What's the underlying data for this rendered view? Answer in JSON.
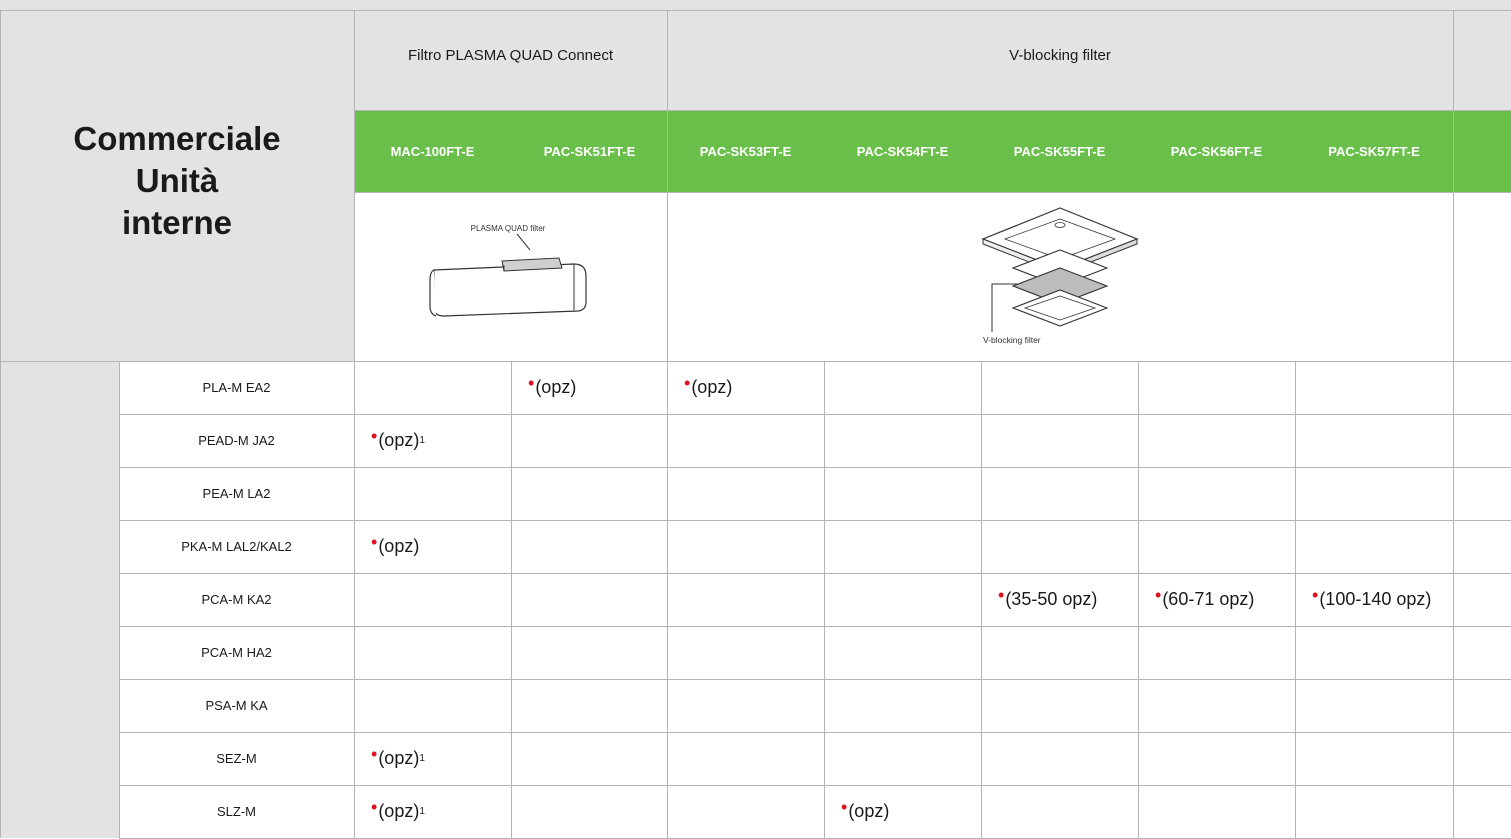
{
  "table": {
    "title_lines": [
      "Commerciale",
      "Unità",
      "interne"
    ],
    "groups": [
      {
        "label": "Filtro PLASMA QUAD Connect"
      },
      {
        "label": "V-blocking filter"
      }
    ],
    "codes": [
      "MAC-100FT-E",
      "PAC-SK51FT-E",
      "PAC-SK53FT-E",
      "PAC-SK54FT-E",
      "PAC-SK55FT-E",
      "PAC-SK56FT-E",
      "PAC-SK57FT-E"
    ],
    "image_labels": {
      "plasma": "PLASMA QUAD filter",
      "vblocking": "V-blocking filter"
    },
    "rows": [
      {
        "model": "PLA-M EA2",
        "values": [
          "",
          "(opz)",
          "(opz)",
          "",
          "",
          "",
          ""
        ]
      },
      {
        "model": "PEAD-M JA2",
        "values": [
          "(opz)¹",
          "",
          "",
          "",
          "",
          "",
          ""
        ]
      },
      {
        "model": "PEA-M LA2",
        "values": [
          "",
          "",
          "",
          "",
          "",
          "",
          ""
        ]
      },
      {
        "model": "PKA-M LAL2/KAL2",
        "values": [
          "(opz)",
          "",
          "",
          "",
          "",
          "",
          ""
        ]
      },
      {
        "model": "PCA-M KA2",
        "values": [
          "",
          "",
          "",
          "",
          "(35-50 opz)",
          "(60-71 opz)",
          "(100-140 opz)"
        ]
      },
      {
        "model": "PCA-M HA2",
        "values": [
          "",
          "",
          "",
          "",
          "",
          "",
          ""
        ]
      },
      {
        "model": "PSA-M KA",
        "values": [
          "",
          "",
          "",
          "",
          "",
          "",
          ""
        ]
      },
      {
        "model": "SEZ-M",
        "values": [
          "(opz)¹",
          "",
          "",
          "",
          "",
          "",
          ""
        ]
      },
      {
        "model": "SLZ-M",
        "values": [
          "(opz)¹",
          "",
          "",
          "(opz)",
          "",
          "",
          ""
        ]
      }
    ],
    "colors": {
      "header_gray": "#e3e3e3",
      "code_green": "#6abf4b",
      "dot_red": "#e0101e",
      "grid_line": "#b4b4b4"
    }
  }
}
